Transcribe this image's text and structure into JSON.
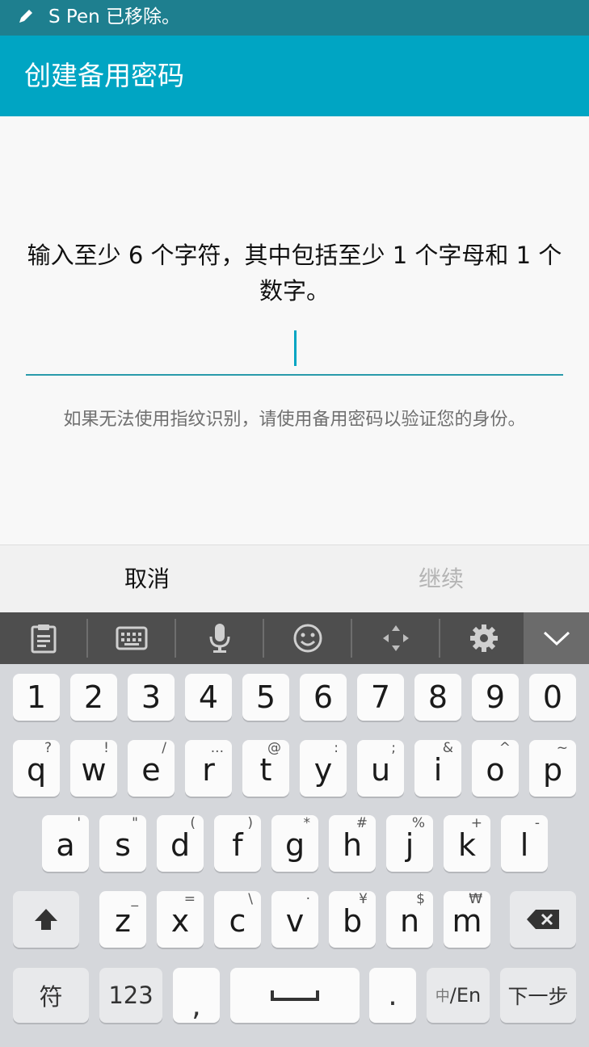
{
  "status_bar": {
    "icon": "pen-icon",
    "text": "S Pen 已移除。"
  },
  "app_bar": {
    "title": "创建备用密码"
  },
  "content": {
    "instruction": "输入至少 6 个字符，其中包括至少 1 个字母和 1 个数字。",
    "password_value": "",
    "hint": "如果无法使用指纹识别，请使用备用密码以验证您的身份。"
  },
  "buttons": {
    "cancel": "取消",
    "continue": "继续"
  },
  "keyboard_toolbar": {
    "icons": [
      "clipboard-icon",
      "keyboard-icon",
      "microphone-icon",
      "emoji-icon",
      "move-icon",
      "settings-icon",
      "chevron-down-icon"
    ]
  },
  "keyboard": {
    "number_row": [
      "1",
      "2",
      "3",
      "4",
      "5",
      "6",
      "7",
      "8",
      "9",
      "0"
    ],
    "row1": [
      {
        "main": "q",
        "sub": "?"
      },
      {
        "main": "w",
        "sub": "!"
      },
      {
        "main": "e",
        "sub": "/"
      },
      {
        "main": "r",
        "sub": "..."
      },
      {
        "main": "t",
        "sub": "@"
      },
      {
        "main": "y",
        "sub": ":"
      },
      {
        "main": "u",
        "sub": ";"
      },
      {
        "main": "i",
        "sub": "&"
      },
      {
        "main": "o",
        "sub": "^"
      },
      {
        "main": "p",
        "sub": "~"
      }
    ],
    "row2": [
      {
        "main": "a",
        "sub": "'"
      },
      {
        "main": "s",
        "sub": "\""
      },
      {
        "main": "d",
        "sub": "("
      },
      {
        "main": "f",
        "sub": ")"
      },
      {
        "main": "g",
        "sub": "*"
      },
      {
        "main": "h",
        "sub": "#"
      },
      {
        "main": "j",
        "sub": "%"
      },
      {
        "main": "k",
        "sub": "+"
      },
      {
        "main": "l",
        "sub": "-"
      }
    ],
    "row3": [
      {
        "main": "z",
        "sub": "_"
      },
      {
        "main": "x",
        "sub": "="
      },
      {
        "main": "c",
        "sub": "\\"
      },
      {
        "main": "v",
        "sub": "·"
      },
      {
        "main": "b",
        "sub": "¥"
      },
      {
        "main": "n",
        "sub": "$"
      },
      {
        "main": "m",
        "sub": "₩"
      }
    ],
    "bottom": {
      "symbols": "符",
      "numbers": "123",
      "comma": ",",
      "space": "",
      "period": ".",
      "lang_small": "中",
      "lang_rest": "/En",
      "next": "下一步"
    }
  },
  "colors": {
    "status_bar": "#1e7f8f",
    "accent": "#00a5c3",
    "underline": "#2a9bab"
  }
}
